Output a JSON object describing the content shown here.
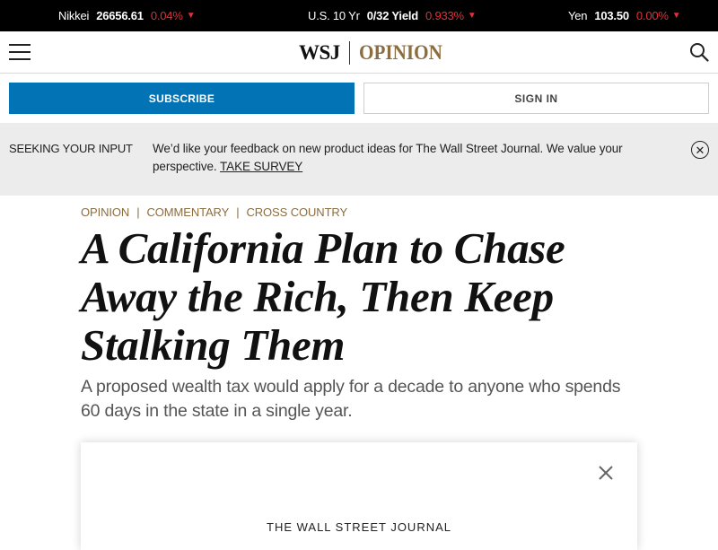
{
  "ticker": [
    {
      "name": "Nikkei",
      "value": "26656.61",
      "change": "0.04%",
      "arrow": "▼"
    },
    {
      "name": "U.S. 10 Yr",
      "value": "0/32 Yield",
      "change": "0.933%",
      "arrow": "▼"
    },
    {
      "name": "Yen",
      "value": "103.50",
      "change": "0.00%",
      "arrow": "▼"
    }
  ],
  "header": {
    "logo_wsj": "WSJ",
    "logo_section": "OPINION",
    "menu_icon": "hamburger-menu-icon",
    "search_icon": "search-icon"
  },
  "account": {
    "subscribe_label": "SUBSCRIBE",
    "signin_label": "SIGN IN"
  },
  "survey": {
    "label": "SEEKING YOUR INPUT",
    "text": "We’d like your feedback on new product ideas for The Wall Street Journal. We value your perspective.",
    "link": "TAKE SURVEY",
    "close_symbol": "✕"
  },
  "article": {
    "breadcrumb": [
      "OPINION",
      "COMMENTARY",
      "CROSS COUNTRY"
    ],
    "headline": "A California Plan to Chase Away the Rich, Then Keep Stalking Them",
    "dek": "A proposed wealth tax would apply for a decade to anyone who spends 60 days in the state in a single year."
  },
  "modal": {
    "brand": "THE WALL STREET JOURNAL"
  },
  "colors": {
    "ticker_bg": "#000000",
    "ticker_down": "#e0303a",
    "accent_blue": "#0274b6",
    "opinion_gold": "#8b6d3f",
    "survey_bg": "#ececec"
  }
}
